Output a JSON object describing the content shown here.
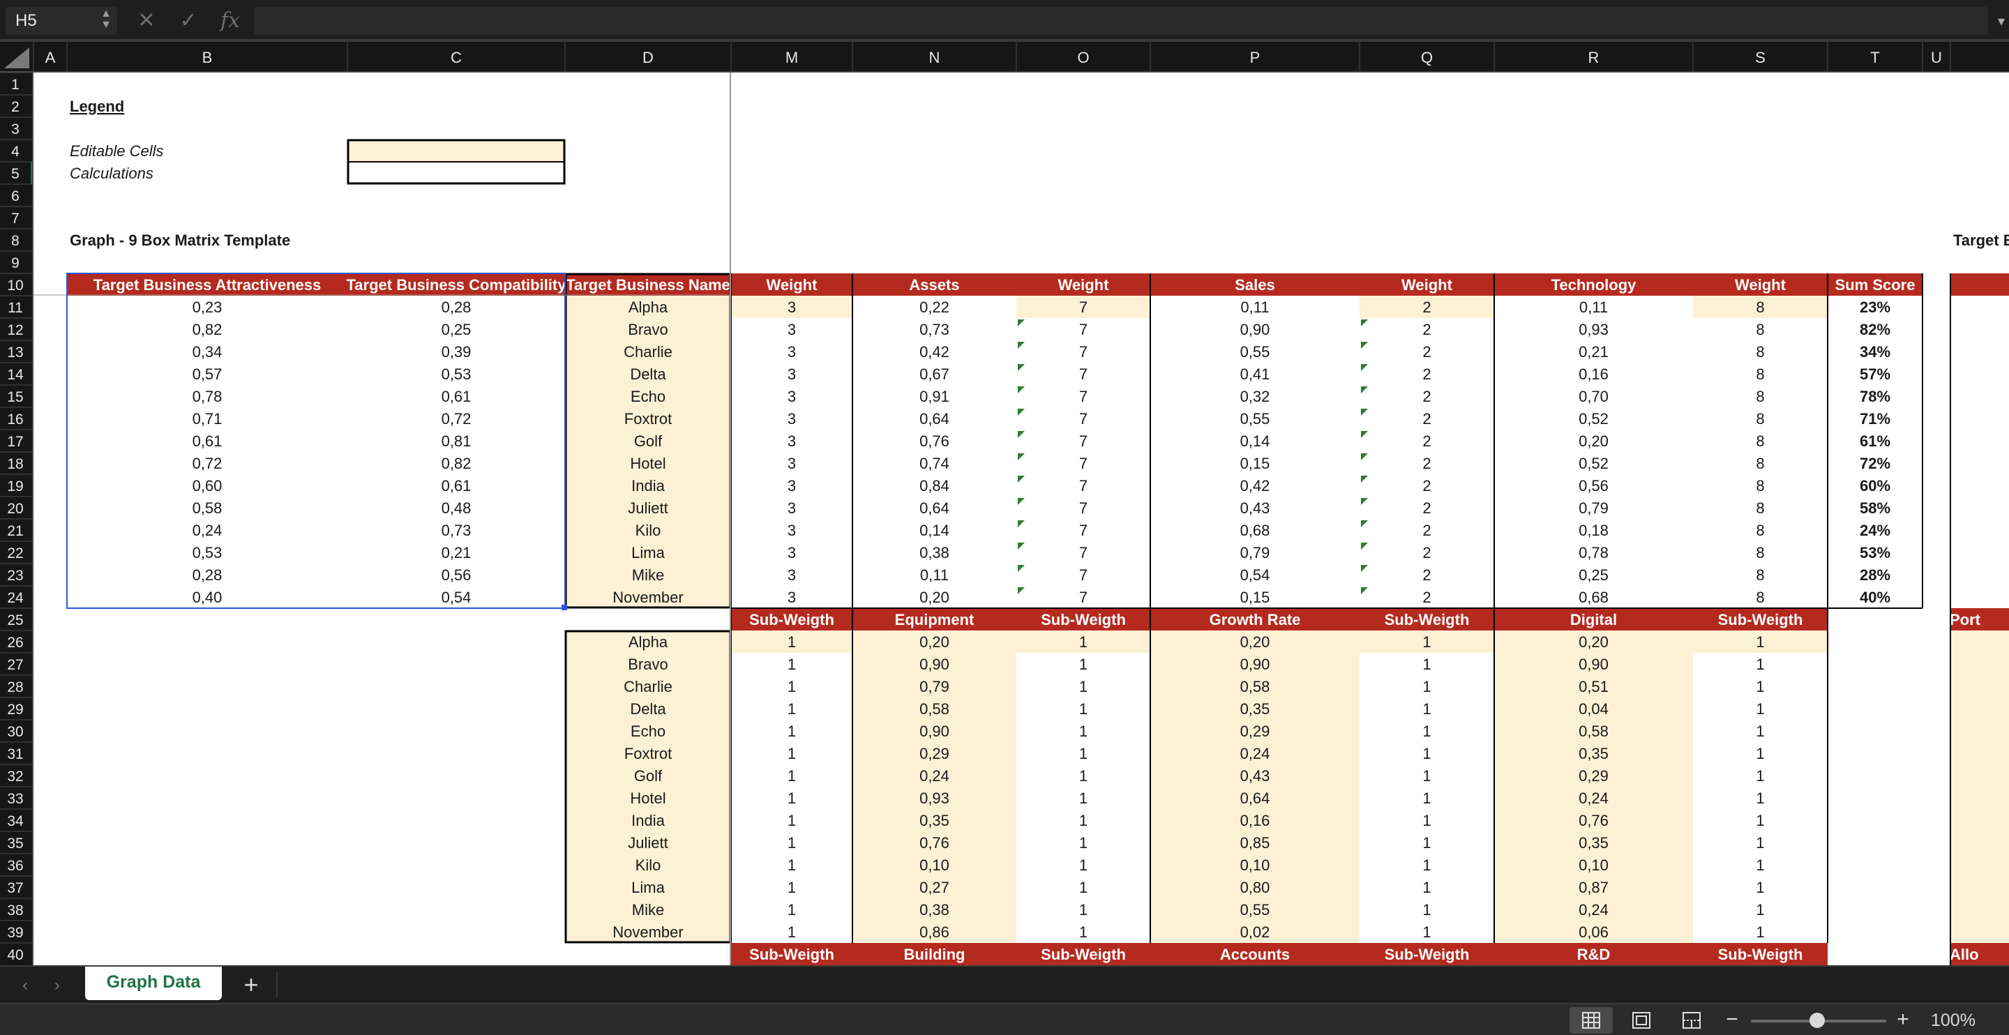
{
  "formula_bar": {
    "name_box": "H5",
    "stepper": "▲▼",
    "cancel_icon": "✕",
    "confirm_icon": "✓",
    "function_icon": "fx",
    "formula": "",
    "expand_icon": "▾"
  },
  "colors": {
    "header_red": "#b52a1f",
    "editable_fill": "#fcf1d4",
    "chrome_dark": "#1e1e1e",
    "selection_blue": "#2b58d6",
    "sheet_tab_green": "#217346"
  },
  "columns": [
    "A",
    "B",
    "C",
    "D",
    "M",
    "N",
    "O",
    "P",
    "Q",
    "R",
    "S",
    "T",
    "U",
    ""
  ],
  "rows": [
    "1",
    "2",
    "3",
    "4",
    "5",
    "6",
    "7",
    "8",
    "9",
    "10",
    "11",
    "12",
    "13",
    "14",
    "15",
    "16",
    "17",
    "18",
    "19",
    "20",
    "21",
    "22",
    "23",
    "24",
    "25",
    "26",
    "27",
    "28",
    "29",
    "30",
    "31",
    "32",
    "33",
    "34",
    "35",
    "36",
    "37",
    "38",
    "39",
    "40"
  ],
  "legend": {
    "title": "Legend",
    "editable_label": "Editable Cells",
    "calculations_label": "Calculations",
    "graph_title": "Graph - 9 Box Matrix Template",
    "right_cut_title": "Target B"
  },
  "table1": {
    "headers": [
      "Target Business Attractiveness",
      "Target Business Compatibility",
      "Target Business Name",
      "Weight",
      "Assets",
      "Weight",
      "Sales",
      "Weight",
      "Technology",
      "Weight",
      "Sum Score"
    ],
    "rows": [
      [
        "0,23",
        "0,28",
        "Alpha",
        "3",
        "0,22",
        "7",
        "0,11",
        "2",
        "0,11",
        "8",
        "23%"
      ],
      [
        "0,82",
        "0,25",
        "Bravo",
        "3",
        "0,73",
        "7",
        "0,90",
        "2",
        "0,93",
        "8",
        "82%"
      ],
      [
        "0,34",
        "0,39",
        "Charlie",
        "3",
        "0,42",
        "7",
        "0,55",
        "2",
        "0,21",
        "8",
        "34%"
      ],
      [
        "0,57",
        "0,53",
        "Delta",
        "3",
        "0,67",
        "7",
        "0,41",
        "2",
        "0,16",
        "8",
        "57%"
      ],
      [
        "0,78",
        "0,61",
        "Echo",
        "3",
        "0,91",
        "7",
        "0,32",
        "2",
        "0,70",
        "8",
        "78%"
      ],
      [
        "0,71",
        "0,72",
        "Foxtrot",
        "3",
        "0,64",
        "7",
        "0,55",
        "2",
        "0,52",
        "8",
        "71%"
      ],
      [
        "0,61",
        "0,81",
        "Golf",
        "3",
        "0,76",
        "7",
        "0,14",
        "2",
        "0,20",
        "8",
        "61%"
      ],
      [
        "0,72",
        "0,82",
        "Hotel",
        "3",
        "0,74",
        "7",
        "0,15",
        "2",
        "0,52",
        "8",
        "72%"
      ],
      [
        "0,60",
        "0,61",
        "India",
        "3",
        "0,84",
        "7",
        "0,42",
        "2",
        "0,56",
        "8",
        "60%"
      ],
      [
        "0,58",
        "0,48",
        "Juliett",
        "3",
        "0,64",
        "7",
        "0,43",
        "2",
        "0,79",
        "8",
        "58%"
      ],
      [
        "0,24",
        "0,73",
        "Kilo",
        "3",
        "0,14",
        "7",
        "0,68",
        "2",
        "0,18",
        "8",
        "24%"
      ],
      [
        "0,53",
        "0,21",
        "Lima",
        "3",
        "0,38",
        "7",
        "0,79",
        "2",
        "0,78",
        "8",
        "53%"
      ],
      [
        "0,28",
        "0,56",
        "Mike",
        "3",
        "0,11",
        "7",
        "0,54",
        "2",
        "0,25",
        "8",
        "28%"
      ],
      [
        "0,40",
        "0,54",
        "November",
        "3",
        "0,20",
        "7",
        "0,15",
        "2",
        "0,68",
        "8",
        "40%"
      ]
    ]
  },
  "table2": {
    "headers": [
      "Sub-Weigth",
      "Equipment",
      "Sub-Weigth",
      "Growth Rate",
      "Sub-Weigth",
      "Digital",
      "Sub-Weigth"
    ],
    "right_cut_header": "Port",
    "rows": [
      [
        "Alpha",
        "1",
        "0,20",
        "1",
        "0,20",
        "1",
        "0,20",
        "1"
      ],
      [
        "Bravo",
        "1",
        "0,90",
        "1",
        "0,90",
        "1",
        "0,90",
        "1"
      ],
      [
        "Charlie",
        "1",
        "0,79",
        "1",
        "0,58",
        "1",
        "0,51",
        "1"
      ],
      [
        "Delta",
        "1",
        "0,58",
        "1",
        "0,35",
        "1",
        "0,04",
        "1"
      ],
      [
        "Echo",
        "1",
        "0,90",
        "1",
        "0,29",
        "1",
        "0,58",
        "1"
      ],
      [
        "Foxtrot",
        "1",
        "0,29",
        "1",
        "0,24",
        "1",
        "0,35",
        "1"
      ],
      [
        "Golf",
        "1",
        "0,24",
        "1",
        "0,43",
        "1",
        "0,29",
        "1"
      ],
      [
        "Hotel",
        "1",
        "0,93",
        "1",
        "0,64",
        "1",
        "0,24",
        "1"
      ],
      [
        "India",
        "1",
        "0,35",
        "1",
        "0,16",
        "1",
        "0,76",
        "1"
      ],
      [
        "Juliett",
        "1",
        "0,76",
        "1",
        "0,85",
        "1",
        "0,35",
        "1"
      ],
      [
        "Kilo",
        "1",
        "0,10",
        "1",
        "0,10",
        "1",
        "0,10",
        "1"
      ],
      [
        "Lima",
        "1",
        "0,27",
        "1",
        "0,80",
        "1",
        "0,87",
        "1"
      ],
      [
        "Mike",
        "1",
        "0,38",
        "1",
        "0,55",
        "1",
        "0,24",
        "1"
      ],
      [
        "November",
        "1",
        "0,86",
        "1",
        "0,02",
        "1",
        "0,06",
        "1"
      ]
    ]
  },
  "table3": {
    "headers": [
      "Sub-Weigth",
      "Building",
      "Sub-Weigth",
      "Accounts",
      "Sub-Weigth",
      "R&D",
      "Sub-Weigth"
    ],
    "right_cut_header": "Allo"
  },
  "sheet_tabs": {
    "prev_icon": "‹",
    "next_icon": "›",
    "active_tab": "Graph Data",
    "add_icon": "+"
  },
  "status_bar": {
    "zoom_minus": "−",
    "zoom_plus": "+",
    "zoom_level": "100%",
    "zoom_fraction": 0.55
  }
}
